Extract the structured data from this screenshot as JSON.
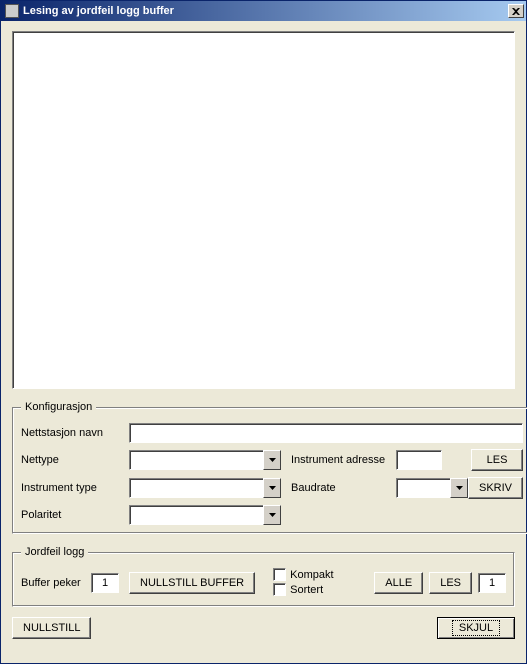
{
  "window": {
    "title": "Lesing av jordfeil logg buffer"
  },
  "config": {
    "legend": "Konfigurasjon",
    "station_label": "Nettstasjon navn",
    "station_value": "",
    "nettype_label": "Nettype",
    "nettype_value": "",
    "instrument_address_label": "Instrument adresse",
    "instrument_address_value": "",
    "les_label": "LES",
    "instrument_type_label": "Instrument type",
    "instrument_type_value": "",
    "baudrate_label": "Baudrate",
    "baudrate_value": "",
    "skriv_label": "SKRIV",
    "polaritet_label": "Polaritet",
    "polaritet_value": ""
  },
  "log": {
    "legend": "Jordfeil logg",
    "buffer_peker_label": "Buffer peker",
    "buffer_peker_value": "1",
    "nullstill_buffer_label": "NULLSTILL BUFFER",
    "kompakt_label": "Kompakt",
    "sortert_label": "Sortert",
    "alle_label": "ALLE",
    "les_label": "LES",
    "right_value": "1"
  },
  "footer": {
    "nullstill_label": "NULLSTILL",
    "skjul_label": "SKJUL"
  }
}
